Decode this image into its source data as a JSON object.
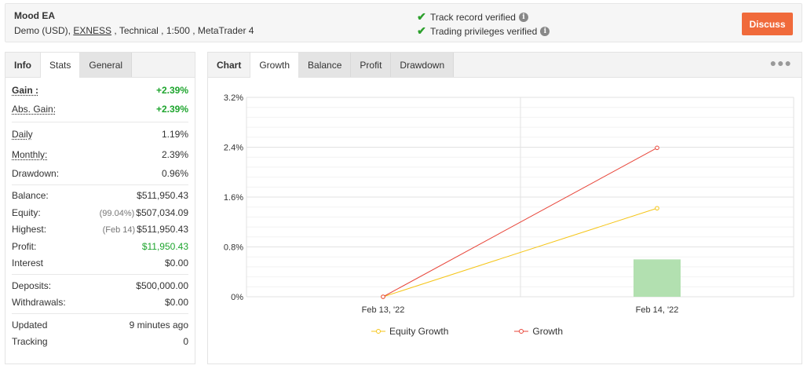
{
  "header": {
    "title": "Mood EA",
    "subtitle_pre": "Demo (USD), ",
    "broker": "EXNESS",
    "subtitle_post": " , Technical , 1:500 , MetaTrader 4",
    "verify1": "Track record verified",
    "verify2": "Trading privileges verified",
    "discuss_label": "Discuss"
  },
  "left_tabs": {
    "info": "Info",
    "stats": "Stats",
    "general": "General"
  },
  "stats": {
    "gain": {
      "label": "Gain :",
      "value": "+2.39%"
    },
    "abs_gain": {
      "label": "Abs. Gain:",
      "value": "+2.39%"
    },
    "daily": {
      "label": "Daily",
      "value": "1.19%"
    },
    "monthly": {
      "label": "Monthly:",
      "value": "2.39%"
    },
    "drawdown": {
      "label": "Drawdown:",
      "value": "0.96%"
    },
    "balance": {
      "label": "Balance:",
      "value": "$511,950.43"
    },
    "equity": {
      "label": "Equity:",
      "paren": "(99.04%)",
      "value": "$507,034.09"
    },
    "highest": {
      "label": "Highest:",
      "paren": "(Feb 14)",
      "value": "$511,950.43"
    },
    "profit": {
      "label": "Profit:",
      "value": "$11,950.43"
    },
    "interest": {
      "label": "Interest",
      "value": "$0.00"
    },
    "deposits": {
      "label": "Deposits:",
      "value": "$500,000.00"
    },
    "withdrawals": {
      "label": "Withdrawals:",
      "value": "$0.00"
    },
    "updated": {
      "label": "Updated",
      "value": "9 minutes ago"
    },
    "tracking": {
      "label": "Tracking",
      "value": "0"
    }
  },
  "right_tabs": {
    "chart": "Chart",
    "growth": "Growth",
    "balance": "Balance",
    "profit": "Profit",
    "drawdown": "Drawdown"
  },
  "colors": {
    "equity_growth": "#f5c518",
    "growth": "#e8463a",
    "bar": "#b2e0b0",
    "accent": "#f06a3b",
    "positive": "#1ea52e"
  },
  "chart_data": {
    "type": "line",
    "categories": [
      "Feb 13, '22",
      "Feb 14, '22"
    ],
    "yticks": [
      "3.2%",
      "2.4%",
      "1.6%",
      "0.8%",
      "0%"
    ],
    "ylim": [
      0,
      3.2
    ],
    "series": [
      {
        "name": "Equity Growth",
        "values": [
          0,
          1.42
        ]
      },
      {
        "name": "Growth",
        "values": [
          0,
          2.39
        ]
      }
    ],
    "bars": [
      null,
      0.6
    ],
    "legend_position": "bottom"
  }
}
